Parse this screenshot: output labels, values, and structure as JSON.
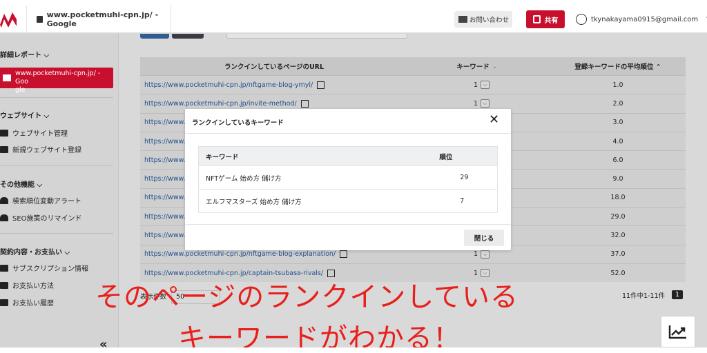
{
  "header": {
    "site_label": "www.pocketmuhi-cpn.jp/ - Google",
    "contact_label": "お問い合わせ",
    "share_label": "共有",
    "user_email": "tkynakayama0915@gmail.com"
  },
  "sidebar": {
    "report_title": "詳細レポート",
    "active_item_line1": "www.pocketmuhi-cpn.jp/ - Goo",
    "active_item_line2": "gle",
    "website_title": "ウェブサイト",
    "website_manage": "ウェブサイト管理",
    "website_register": "新規ウェブサイト登録",
    "other_title": "その他機能",
    "rank_alert": "検索順位変動アラート",
    "seo_remind": "SEO施策のリマインド",
    "contract_title": "契約内容・お支払い",
    "subscription": "サブスクリプション情報",
    "payment_method": "お支払い方法",
    "payment_history": "お支払い履歴",
    "collapse_glyph": "«"
  },
  "table": {
    "headers": [
      "ランクインしているページのURL",
      "キーワード",
      "登録キーワードの平均順位"
    ],
    "header_sort_kw": "⌄",
    "header_sort_avg": "⌃",
    "rows": [
      {
        "url": "https://www.pocketmuhi-cpn.jp/nftgame-blog-ymyl/",
        "kw": "1",
        "avg": "1.0"
      },
      {
        "url": "https://www.pocketmuhi-cpn.jp/invite-method/",
        "kw": "1",
        "avg": "2.0"
      },
      {
        "url": "https://www.p",
        "kw": "1",
        "avg": "3.0"
      },
      {
        "url": "https://www.p",
        "kw": "1",
        "avg": "4.0"
      },
      {
        "url": "https://www.p",
        "kw": "1",
        "avg": "6.0"
      },
      {
        "url": "https://www.p",
        "kw": "1",
        "avg": "9.0"
      },
      {
        "url": "https://www.p",
        "kw": "1",
        "avg": "18.0"
      },
      {
        "url": "https://www.p",
        "kw": "1",
        "avg": "29.0"
      },
      {
        "url": "https://www.p",
        "kw": "1",
        "avg": "32.0"
      },
      {
        "url": "https://www.pocketmuhi-cpn.jp/nftgame-blog-explanation/",
        "kw": "1",
        "avg": "37.0"
      },
      {
        "url": "https://www.pocketmuhi-cpn.jp/captain-tsubasa-rivals/",
        "kw": "1",
        "avg": "52.0"
      }
    ],
    "per_page_label": "表示件数",
    "per_page_value": "50",
    "range_label": "11件中1-11件",
    "page_number": "1"
  },
  "modal": {
    "title": "ランクインしているキーワード",
    "close_glyph": "✕",
    "col_keyword": "キーワード",
    "col_rank": "順位",
    "rows": [
      {
        "keyword": "NFTゲーム 始め方 儲け方",
        "rank": "29"
      },
      {
        "keyword": "エルフマスターズ 始め方 儲け方",
        "rank": "7"
      }
    ],
    "close_button": "閉じる"
  },
  "caption": {
    "line1": "そのページのランクインしている",
    "line2": "キーワードがわかる！"
  },
  "colors": {
    "brand_red": "#c8102e",
    "caption_red": "#e8201c",
    "link_blue": "#1f4f8c"
  }
}
